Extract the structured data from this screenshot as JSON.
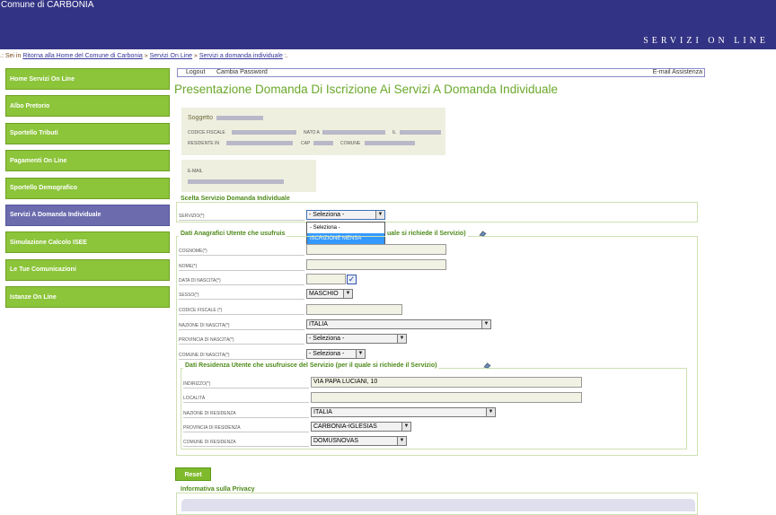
{
  "header": {
    "comune": "Comune di CARBONIA",
    "servizi": "SERVIZI ON LINE"
  },
  "breadcrumb": {
    "prefix": ".: Sei in",
    "items": [
      "Ritorna alla Home del Comune di Carbonia",
      "Servizi On Line",
      "Servizi a domanda individuale"
    ],
    "sep": "»",
    "suffix": ":."
  },
  "nav": {
    "items": [
      {
        "label": "Home Servizi On Line"
      },
      {
        "label": "Albo Pretorio"
      },
      {
        "label": "Sportello Tributi"
      },
      {
        "label": "Pagamenti On Line"
      },
      {
        "label": "Sportello Demografico"
      },
      {
        "label": "Servizi A Domanda Individuale",
        "active": true
      },
      {
        "label": "Simulazione Calcolo ISEE"
      },
      {
        "label": "Le Tue Comunicazioni"
      },
      {
        "label": "Istanze On Line"
      }
    ]
  },
  "topbar": {
    "logout": "Logout",
    "cambia_password": "Cambia Password",
    "email_assistenza": "E-mail Assistenza"
  },
  "page_title": "Presentazione Domanda Di Iscrizione Ai Servizi A Domanda Individuale",
  "soggetto": {
    "title": "Soggetto",
    "codice_fiscale_label": "CODICE FISCALE",
    "nato_a_label": "NATO A",
    "il_label": "IL",
    "residente_label": "RESIDENTE IN",
    "cap_label": "CAP",
    "comune_label": "COMUNE",
    "email_label": "E-MAIL"
  },
  "scelta": {
    "legend": "Scelta Servizio Domanda Individuale",
    "servizio_label": "SERVIZIO(*)",
    "servizio_value": "- Seleziona -",
    "options": [
      "- Seleziona -",
      "ISCRIZIONE MENSA"
    ]
  },
  "anagrafici": {
    "legend_start": "Dati Anagrafici Utente che usufruis",
    "legend_end": "uale si richiede il Servizio)",
    "cognome_label": "COGNOME(*)",
    "nome_label": "NOME(*)",
    "data_nascita_label": "DATA DI NASCITA(*)",
    "sesso_label": "SESSO(*)",
    "sesso_value": "MASCHIO",
    "codice_fiscale_label": "CODICE FISCALE (*)",
    "nazione_label": "NAZIONE DI NASCITA(*)",
    "nazione_value": "ITALIA",
    "provincia_label": "PROVINCIA DI NASCITA(*)",
    "provincia_value": "- Seleziona -",
    "comune_label": "COMUNE DI NASCITA(*)",
    "comune_value": "- Seleziona -"
  },
  "residenza": {
    "legend": "Dati Residenza Utente che usufruisce del Servizio (per il quale si richiede il Servizio)",
    "indirizzo_label": "INDIRIZZO(*)",
    "indirizzo_value": "VIA PAPA LUCIANI, 10",
    "localita_label": "LOCALITÀ",
    "nazione_label": "NAZIONE DI RESIDENZA",
    "nazione_value": "ITALIA",
    "provincia_label": "PROVINCIA DI RESIDENZA",
    "provincia_value": "CARBONIA-IGLESIAS",
    "comune_label": "COMUNE DI RESIDENZA",
    "comune_value": "DOMUSNOVAS"
  },
  "reset_label": "Reset",
  "privacy_legend": "Informativa sulla Privacy",
  "colors": {
    "header_bg": "#333385",
    "nav_green": "#8cc43a",
    "nav_active": "#6b6bae",
    "title_green": "#6aa82a"
  }
}
